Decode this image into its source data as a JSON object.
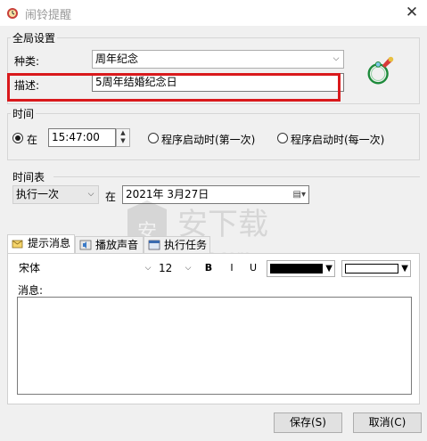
{
  "window": {
    "title": "闹铃提醒",
    "close_glyph": "✕"
  },
  "global": {
    "group_title": "全局设置",
    "kind_label": "种类:",
    "kind_value": "周年纪念",
    "desc_label": "描述:",
    "desc_value": "5周年结婚纪念日"
  },
  "time": {
    "group_title": "时间",
    "at_label": "在",
    "time_value": "15:47:00",
    "option_first_start": "程序启动时(第一次)",
    "option_every_start": "程序启动时(每一次)"
  },
  "schedule": {
    "group_title": "时间表",
    "frequency": "执行一次",
    "at_label": "在",
    "date_value": "2021年 3月27日"
  },
  "tabs": [
    {
      "label": "提示消息"
    },
    {
      "label": "播放声音"
    },
    {
      "label": "执行任务"
    }
  ],
  "message": {
    "font_name": "宋体",
    "font_size": "12",
    "bold_label": "B",
    "italic_label": "I",
    "underline_label": "U",
    "fore_color": "#000000",
    "back_color": "#ffffff",
    "message_label": "消息:"
  },
  "buttons": {
    "save": "保存(S)",
    "cancel": "取消(C)"
  },
  "watermark": {
    "text": "安下载",
    "sub": "anxz.com"
  },
  "colors": {
    "highlight": "#d9191c"
  }
}
